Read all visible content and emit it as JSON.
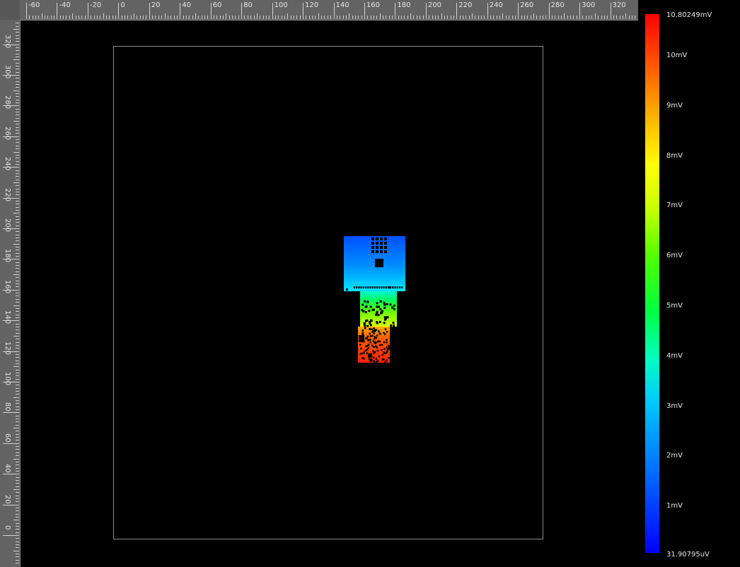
{
  "ruler_top": {
    "labels": [
      "-60",
      "-40",
      "-20",
      "0",
      "20",
      "40",
      "60",
      "80",
      "100",
      "120",
      "140",
      "160",
      "180",
      "200",
      "220",
      "240",
      "260",
      "280",
      "300",
      "320"
    ]
  },
  "ruler_left": {
    "labels": [
      "0",
      "20",
      "40",
      "60",
      "80",
      "100",
      "120",
      "140",
      "160",
      "180",
      "200",
      "220",
      "240",
      "260",
      "280",
      "300",
      "320"
    ]
  },
  "colorbar": {
    "max_label": "10.80249mV",
    "min_label": "31.90795uV",
    "ticks": [
      "10mV",
      "9mV",
      "8mV",
      "7mV",
      "6mV",
      "5mV",
      "4mV",
      "3mV",
      "2mV",
      "1mV"
    ],
    "colors": {
      "low": "#0000ff",
      "mid": "#00ff40",
      "high": "#ff0000"
    }
  },
  "scene": {
    "background": "#000000",
    "board_outline_color": "#8c8c8c"
  }
}
